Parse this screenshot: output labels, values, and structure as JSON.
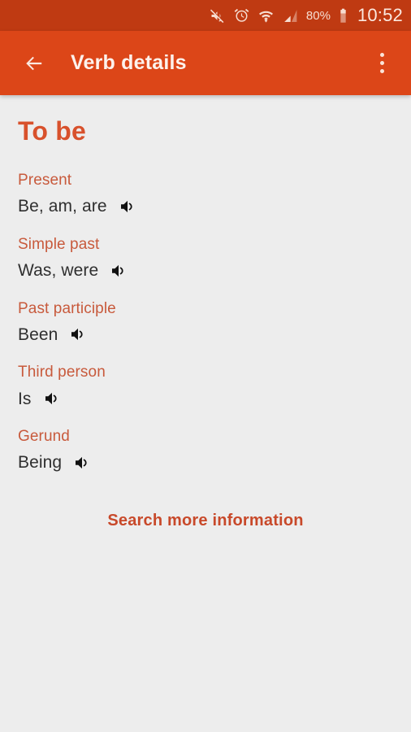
{
  "status_bar": {
    "icons": [
      "mute-icon",
      "alarm-icon",
      "wifi-download-icon",
      "signal-icon"
    ],
    "battery_percent": "80%",
    "time": "10:52"
  },
  "app_bar": {
    "back_icon": "back-arrow-icon",
    "title": "Verb details",
    "overflow_icon": "overflow-menu-icon"
  },
  "content": {
    "verb_title": "To be",
    "forms": [
      {
        "label": "Present",
        "value": "Be, am, are",
        "speaker_icon": "speaker-icon"
      },
      {
        "label": "Simple past",
        "value": "Was, were",
        "speaker_icon": "speaker-icon"
      },
      {
        "label": "Past participle",
        "value": "Been",
        "speaker_icon": "speaker-icon"
      },
      {
        "label": "Third person",
        "value": "Is",
        "speaker_icon": "speaker-icon"
      },
      {
        "label": "Gerund",
        "value": "Being",
        "speaker_icon": "speaker-icon"
      }
    ],
    "search_more_label": "Search more information"
  },
  "colors": {
    "status_bar_bg": "#bf3a12",
    "app_bar_bg": "#dc4618",
    "content_bg": "#ededed",
    "accent": "#d8512c",
    "label": "#c85a3c",
    "value_text": "#2f2f2f",
    "link": "#c8492a"
  }
}
